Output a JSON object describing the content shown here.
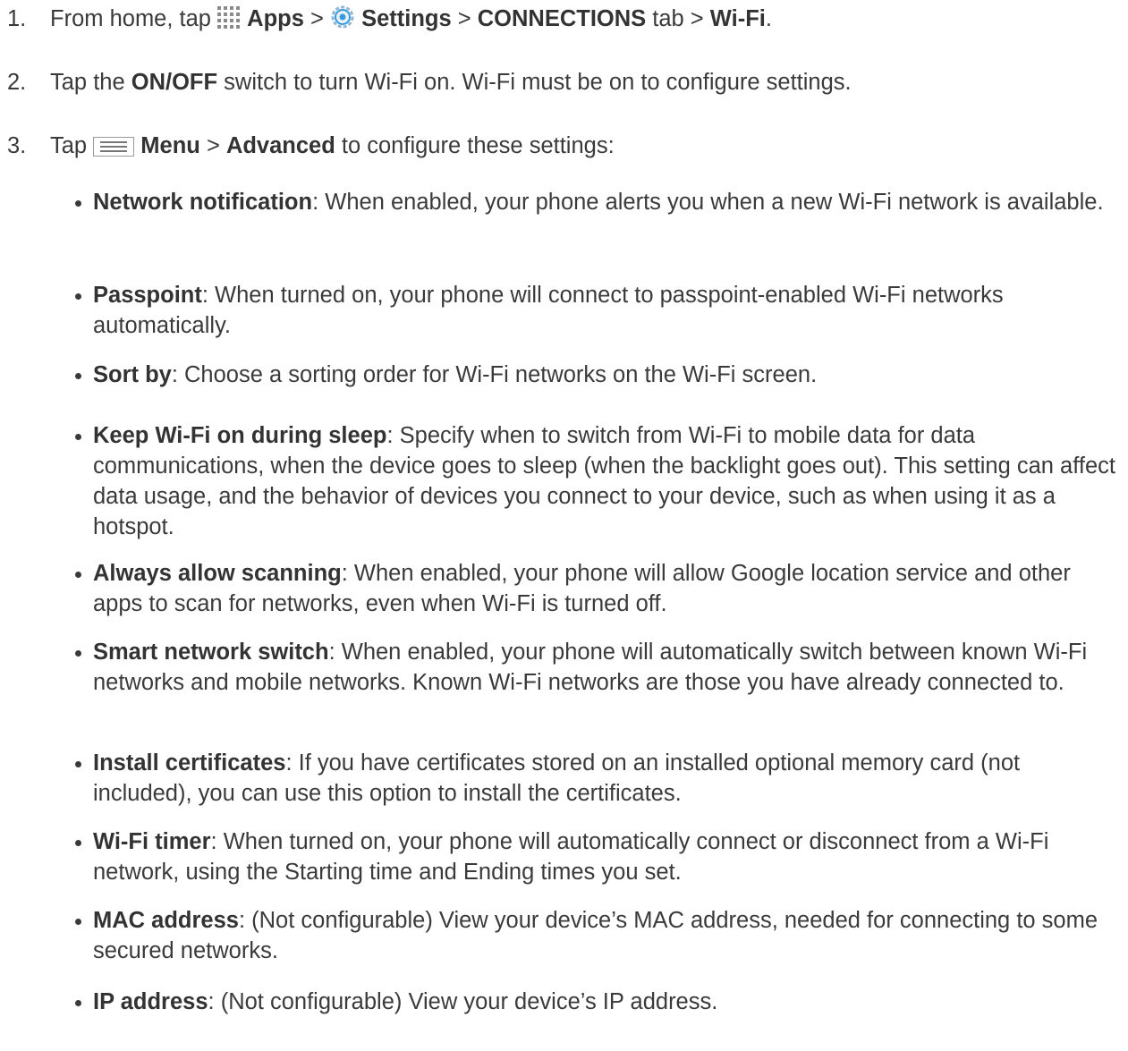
{
  "steps": [
    {
      "num": "1.",
      "t1": "From home, tap ",
      "apps": "Apps",
      "t2": " > ",
      "settings": "Settings",
      "t3": " > ",
      "connections": "CONNECTIONS",
      "t4": " tab > ",
      "wifi": "Wi-Fi",
      "t5": "."
    },
    {
      "num": "2.",
      "t1": "Tap the ",
      "onoff": "ON/OFF",
      "t2": " switch to turn Wi-Fi on. Wi-Fi must be on to configure settings."
    },
    {
      "num": "3.",
      "t1": "Tap ",
      "menu": "Menu",
      "t2": " > ",
      "advanced": "Advanced",
      "t3": " to configure these settings:"
    }
  ],
  "settings_list": [
    {
      "term": "Network notification",
      "desc": ": When enabled, your phone alerts you when a new Wi-Fi network is available."
    },
    {
      "term": "Passpoint",
      "desc": ": When turned on, your phone will connect to passpoint-enabled Wi-Fi networks automatically."
    },
    {
      "term": "Sort by",
      "desc": ": Choose a sorting order for Wi-Fi networks on the Wi-Fi screen."
    },
    {
      "term": "Keep Wi-Fi on during sleep",
      "desc": ": Specify when to switch from Wi-Fi to mobile data for data communications, when the device goes to sleep (when the backlight goes out). This setting can affect data usage, and the behavior of devices you connect to your device, such as when using it as a hotspot."
    },
    {
      "term": "Always allow scanning",
      "desc": ": When enabled, your phone will allow Google location service and other apps to scan for networks, even when Wi-Fi is turned off."
    },
    {
      "term": "Smart network switch",
      "desc": ": When enabled, your phone will automatically switch between known Wi-Fi networks and mobile networks. Known Wi-Fi networks are those you have already connected to."
    },
    {
      "term": "Install certificates",
      "desc": ": If you have certificates stored on an installed optional memory card (not included), you can use this option to install the certificates."
    },
    {
      "term": "Wi-Fi timer",
      "desc": ": When turned on, your phone will automatically connect or disconnect from a Wi-Fi network, using the Starting time and Ending times you set."
    },
    {
      "term": "MAC address",
      "desc": ": (Not configurable) View your device’s MAC address, needed for connecting to some secured networks."
    },
    {
      "term": "IP address",
      "desc": ": (Not configurable) View your device’s IP address."
    }
  ],
  "icons": {
    "apps": "apps-grid-icon",
    "settings": "settings-gear-icon",
    "menu": "menu-icon"
  },
  "colors": {
    "text": "#3a3a3a",
    "settings_icon_blue": "#3a9ad9"
  }
}
